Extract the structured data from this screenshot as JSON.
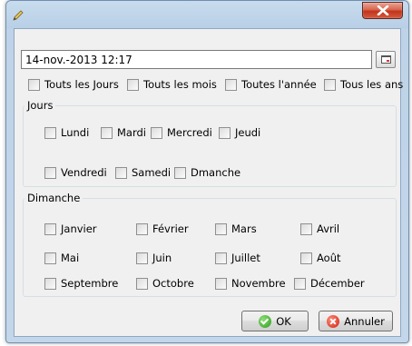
{
  "window": {
    "close_icon": "close-icon",
    "app_icon": "pencil-icon"
  },
  "date_field": {
    "value": "14-nov.-2013 12:17",
    "picker_icon": "calendar-icon"
  },
  "options": {
    "all_days": "Touts les Jours",
    "all_months": "Touts les mois",
    "all_years": "Toutes l'année",
    "all_ans": "Tous les ans"
  },
  "days_group": {
    "title": "Jours",
    "days": [
      "Lundi",
      "Mardi",
      "Mercredi",
      "Jeudi",
      "Vendredi",
      "Samedi",
      "Dmanche"
    ]
  },
  "months_group": {
    "title": "Dimanche",
    "months": [
      "Janvier",
      "Février",
      "Mars",
      "Avril",
      "Mai",
      "Juin",
      "Juillet",
      "Août",
      "Septembre",
      "Octobre",
      "Novembre",
      "Décember"
    ]
  },
  "buttons": {
    "ok": "OK",
    "cancel": "Annuler"
  },
  "colors": {
    "titlebar": "#c3d6ea",
    "close": "#c3341b",
    "ok_icon": "#2f9a1c",
    "cancel_icon": "#d2220c"
  }
}
